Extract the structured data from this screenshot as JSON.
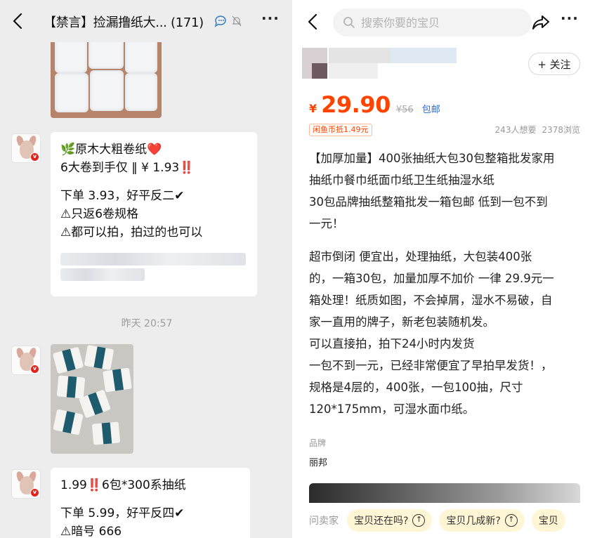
{
  "chat": {
    "title": "【禁言】捡漏撸纸大... (171)",
    "timestamp": "昨天 20:57",
    "message1": {
      "line1": "🌿原木大粗卷纸❤️",
      "line2_main": "6大卷到手仅 ‖ ¥ 1.93",
      "line2_mark": "‼️",
      "line3": "下单 3.93，好平反二✔",
      "line4": "⚠只返6卷规格",
      "line5": "⚠都可以拍，拍过的也可以"
    },
    "message2": {
      "line1_price": "1.99",
      "line1_mark": "‼️",
      "line1_rest": "6包*300系抽纸",
      "line2": "下单 5.99，好平反四✔",
      "line3": "⚠暗号 666"
    }
  },
  "product": {
    "search_placeholder": "搜索你要的宝贝",
    "follow_label": "+ 关注",
    "price_symbol": "¥",
    "price": "29.90",
    "original_price": "¥56",
    "shipping": "包邮",
    "coin_tag": "闲鱼币抵1.49元",
    "wants": "243人想要",
    "views": "2378浏览",
    "description": [
      "【加厚加量】400张抽纸大包30包整箱批发家用",
      "抽纸巾餐巾纸面巾纸卫生纸抽湿水纸",
      "30包品牌抽纸整箱批发一箱包邮  低到一包不到",
      "一元！"
    ],
    "description2": [
      "超市倒闭    便宜出，处理抽纸，大包装400张",
      "的，一箱30包，加量加厚不加价 一律 29.9元一",
      "箱处理！纸质如图，不会掉屑，湿水不易破，自",
      "家一直用的牌子，新老包装随机发。",
      "可以直接拍，拍下24小时内发货",
      "一包不到一元，已经非常便宜了早拍早发货！，",
      "规格是4层的，400张，一包100抽，尺寸",
      "120*175mm，可湿水面巾纸。"
    ],
    "brand_label": "品牌",
    "brand_value": "丽邦",
    "ask_label": "问卖家",
    "chips": [
      "宝贝还在吗?",
      "宝贝几成新?",
      "宝贝"
    ]
  },
  "colors": {
    "price": "#ff4400",
    "chat_bg": "#ededed",
    "chip_bg": "#fff6d6"
  },
  "icons": [
    "back-arrow-icon",
    "voice-chat-icon",
    "mute-bell-icon",
    "more-icon",
    "search-icon",
    "share-icon",
    "arrow-up-circle-icon"
  ]
}
